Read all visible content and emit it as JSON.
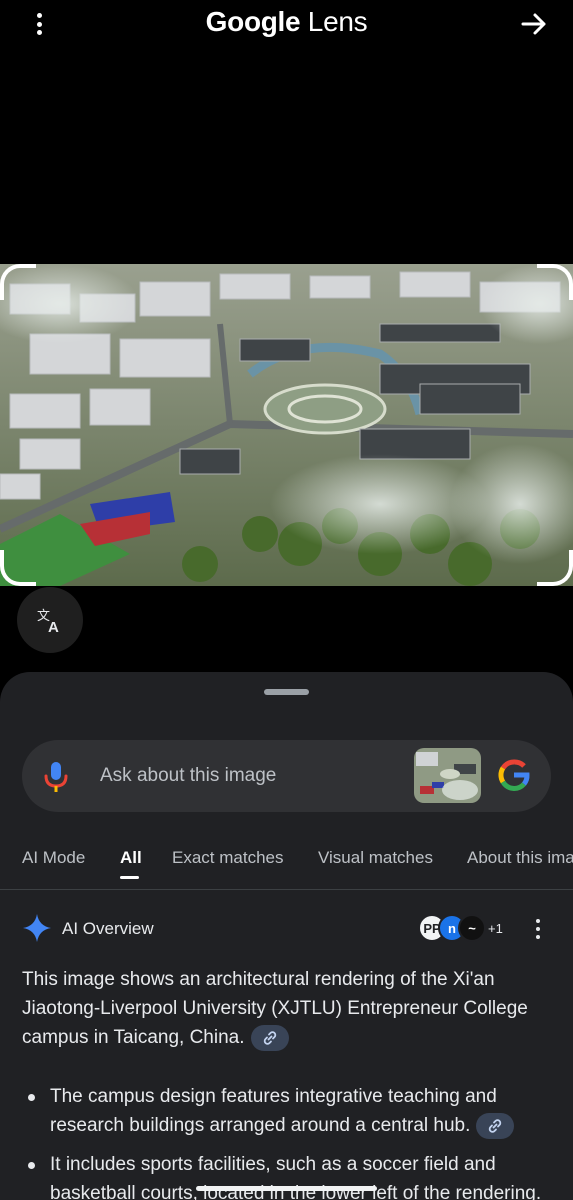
{
  "header": {
    "brand": "Google",
    "product": "Lens",
    "menu_icon": "more-vert-icon",
    "share_icon": "arrow-right-icon"
  },
  "image": {
    "description_icon": "aerial-campus-rendering"
  },
  "translate_icon": "translate-icon",
  "search": {
    "placeholder": "Ask about this image",
    "mic_icon": "mic-icon",
    "google_icon": "google-g-icon"
  },
  "tabs": [
    {
      "label": "AI Mode",
      "active": false
    },
    {
      "label": "All",
      "active": true
    },
    {
      "label": "Exact matches",
      "active": false
    },
    {
      "label": "Visual matches",
      "active": false
    },
    {
      "label": "About this ima",
      "active": false
    }
  ],
  "overview": {
    "title": "AI Overview",
    "source_count": "+1",
    "intro": "This image shows an architectural rendering of the Xi'an Jiaotong-Liverpool University (XJTLU) Entrepreneur College campus in Taicang, China.",
    "bullets": [
      "The campus design features integrative teaching and research buildings arranged around a central hub.",
      "It includes sports facilities, such as a soccer field and basketball courts, located in the lower left of the rendering."
    ]
  },
  "colors": {
    "background": "#000000",
    "sheet": "#202124",
    "searchbar": "#303134",
    "chip": "#394457",
    "ai_blue": "#4285f4"
  }
}
